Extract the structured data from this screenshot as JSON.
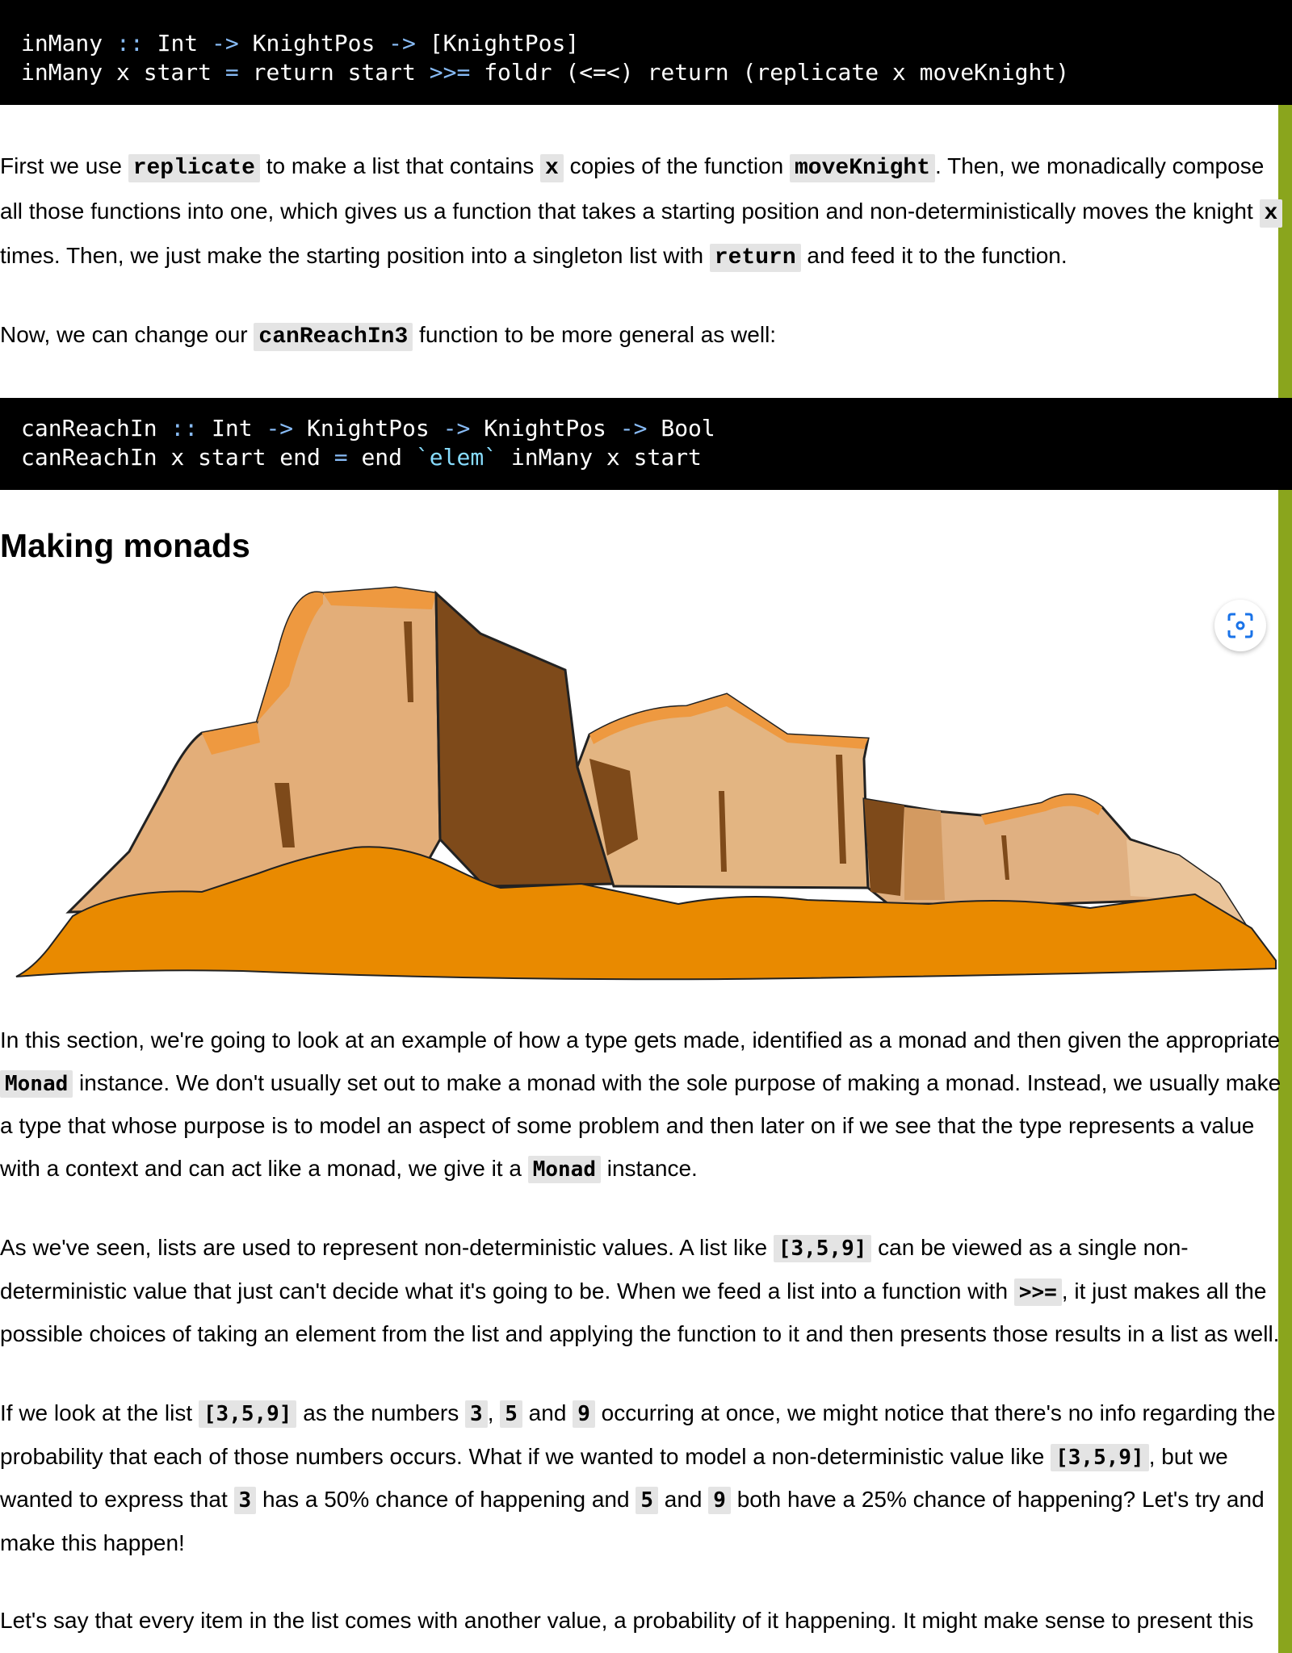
{
  "code_blocks": {
    "in_many": [
      [
        "inMany",
        " :: ",
        "Int",
        " -> ",
        "KnightPos",
        " -> ",
        "[KnightPos]"
      ],
      [
        "inMany x start",
        " = ",
        "return start",
        " >>= ",
        "foldr (<=<) return (replicate x moveKnight)"
      ]
    ],
    "can_reach": [
      [
        "canReachIn",
        " :: ",
        "Int",
        " -> ",
        "KnightPos",
        " -> ",
        "KnightPos",
        " -> ",
        "Bool"
      ],
      [
        "canReachIn x start end",
        " = ",
        "end ",
        "`elem`",
        " inMany x start"
      ]
    ]
  },
  "p1": [
    "First we use ",
    "replicate",
    " to make a list that contains ",
    "x",
    " copies of the function ",
    "moveKnight",
    ". Then, we monadically compose all those functions into one, which gives us a function that takes a starting position and non-deterministically moves the knight ",
    "x",
    " times. Then, we just make the starting position into a singleton list with ",
    "return",
    " and feed it to the function."
  ],
  "p2": [
    "Now, we can change our ",
    "canReachIn3",
    " function to be more general as well:"
  ],
  "heading": "Making monads",
  "p3": [
    "In this section, we're going to look at an example of how a type gets made, identified as a monad and then given the appropriate ",
    "Monad",
    " instance. We don't usually set out to make a monad with the sole purpose of making a monad. Instead, we usually make a type that whose purpose is to model an aspect of some problem and then later on if we see that the type represents a value with a context and can act like a monad, we give it a ",
    "Monad",
    " instance."
  ],
  "p4": [
    "As we've seen, lists are used to represent non-deterministic values. A list like ",
    "[3,5,9]",
    " can be viewed as a single non-deterministic value that just can't decide what it's going to be. When we feed a list into a function with ",
    ">>=",
    ", it just makes all the possible choices of taking an element from the list and applying the function to it and then presents those results in a list as well."
  ],
  "p5": [
    "If we look at the list ",
    "[3,5,9]",
    " as the numbers ",
    "3",
    ", ",
    "5",
    " and ",
    "9",
    " occurring at once, we might notice that there's no info regarding the probability that each of those numbers occurs. What if we wanted to model a non-deterministic value like ",
    "[3,5,9]",
    ", but we wanted to express that ",
    "3",
    " has a 50% chance of happening and ",
    "5",
    " and ",
    "9",
    " both have a 25% chance of happening? Let's try and make this happen!"
  ],
  "p6": "Let's say that every item in the list comes with another value, a probability of it happening. It might make sense to present this",
  "image": {
    "icon": "lens-search-icon"
  },
  "colors": {
    "code_bg": "#000000",
    "operator": "#88bbf5",
    "accent_bar": "#8aa51d",
    "inline_code_bg": "#e4e4e4",
    "sand": "#e98a00"
  }
}
